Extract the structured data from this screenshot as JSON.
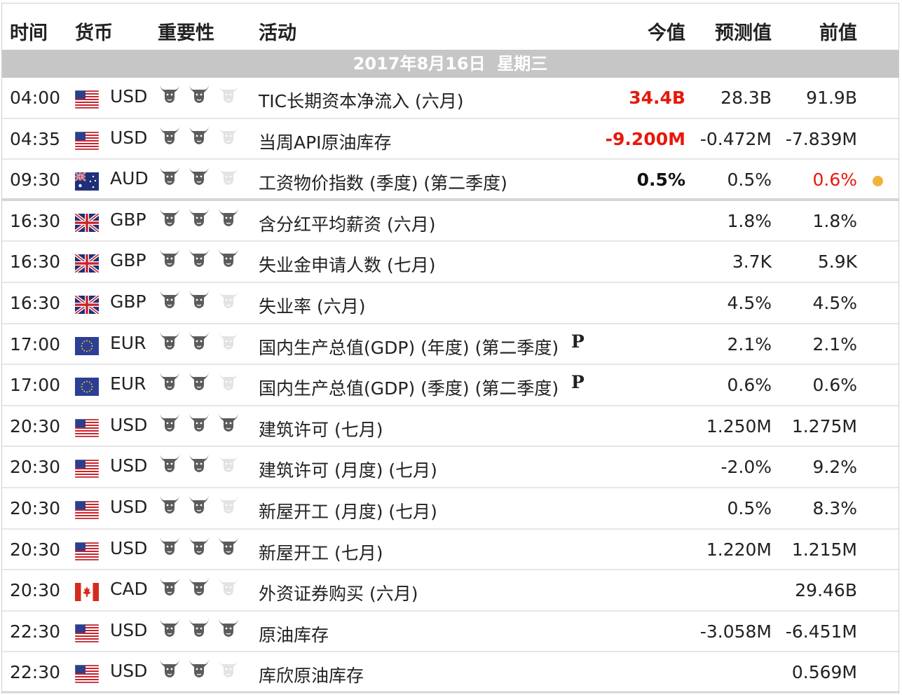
{
  "header": {
    "time": "时间",
    "currency": "货币",
    "importance": "重要性",
    "event": "活动",
    "actual": "今值",
    "forecast": "预测值",
    "previous": "前值"
  },
  "date_label": "2017年8月16日  星期三",
  "colors": {
    "red": "#e8180c",
    "bull_on": "#5b5b5b",
    "bull_off": "#e3e3e3",
    "dot": "#f0b33b",
    "band": "#c6c6c6"
  },
  "rows": [
    {
      "time": "04:00",
      "flag": "us-flag-icon",
      "currency": "USD",
      "importance": 2,
      "event": "TIC长期资本净流入 (六月)",
      "actual": "34.4B",
      "actual_color": "#e8180c",
      "forecast": "28.3B",
      "previous": "91.9B"
    },
    {
      "time": "04:35",
      "flag": "us-flag-icon",
      "currency": "USD",
      "importance": 2,
      "event": "当周API原油库存",
      "actual": "-9.200M",
      "actual_color": "#e8180c",
      "forecast": "-0.472M",
      "previous": "-7.839M"
    },
    {
      "time": "09:30",
      "flag": "au-flag-icon",
      "currency": "AUD",
      "importance": 2,
      "event": "工资物价指数 (季度) (第二季度)",
      "actual": "0.5%",
      "actual_color": "#111111",
      "forecast": "0.5%",
      "previous": "0.6%",
      "previous_color": "#e8180c",
      "dot": true
    },
    {
      "time": "16:30",
      "flag": "gb-flag-icon",
      "currency": "GBP",
      "importance": 3,
      "event": "含分红平均薪资 (六月)",
      "actual": "",
      "forecast": "1.8%",
      "previous": "1.8%"
    },
    {
      "time": "16:30",
      "flag": "gb-flag-icon",
      "currency": "GBP",
      "importance": 3,
      "event": "失业金申请人数 (七月)",
      "actual": "",
      "forecast": "3.7K",
      "previous": "5.9K"
    },
    {
      "time": "16:30",
      "flag": "gb-flag-icon",
      "currency": "GBP",
      "importance": 2,
      "event": "失业率 (六月)",
      "actual": "",
      "forecast": "4.5%",
      "previous": "4.5%"
    },
    {
      "time": "17:00",
      "flag": "eu-flag-icon",
      "currency": "EUR",
      "importance": 2,
      "event": "国内生产总值(GDP) (年度) (第二季度)",
      "preliminary": "P",
      "actual": "",
      "forecast": "2.1%",
      "previous": "2.1%"
    },
    {
      "time": "17:00",
      "flag": "eu-flag-icon",
      "currency": "EUR",
      "importance": 2,
      "event": "国内生产总值(GDP) (季度) (第二季度)",
      "preliminary": "P",
      "actual": "",
      "forecast": "0.6%",
      "previous": "0.6%"
    },
    {
      "time": "20:30",
      "flag": "us-flag-icon",
      "currency": "USD",
      "importance": 3,
      "event": "建筑许可 (七月)",
      "actual": "",
      "forecast": "1.250M",
      "previous": "1.275M"
    },
    {
      "time": "20:30",
      "flag": "us-flag-icon",
      "currency": "USD",
      "importance": 2,
      "event": "建筑许可 (月度) (七月)",
      "actual": "",
      "forecast": "-2.0%",
      "previous": "9.2%"
    },
    {
      "time": "20:30",
      "flag": "us-flag-icon",
      "currency": "USD",
      "importance": 2,
      "event": "新屋开工 (月度) (七月)",
      "actual": "",
      "forecast": "0.5%",
      "previous": "8.3%"
    },
    {
      "time": "20:30",
      "flag": "us-flag-icon",
      "currency": "USD",
      "importance": 3,
      "event": "新屋开工 (七月)",
      "actual": "",
      "forecast": "1.220M",
      "previous": "1.215M"
    },
    {
      "time": "20:30",
      "flag": "ca-flag-icon",
      "currency": "CAD",
      "importance": 2,
      "event": "外资证券购买 (六月)",
      "actual": "",
      "forecast": "",
      "previous": "29.46B"
    },
    {
      "time": "22:30",
      "flag": "us-flag-icon",
      "currency": "USD",
      "importance": 3,
      "event": "原油库存",
      "actual": "",
      "forecast": "-3.058M",
      "previous": "-6.451M"
    },
    {
      "time": "22:30",
      "flag": "us-flag-icon",
      "currency": "USD",
      "importance": 2,
      "event": "库欣原油库存",
      "actual": "",
      "forecast": "",
      "previous": "0.569M"
    }
  ]
}
